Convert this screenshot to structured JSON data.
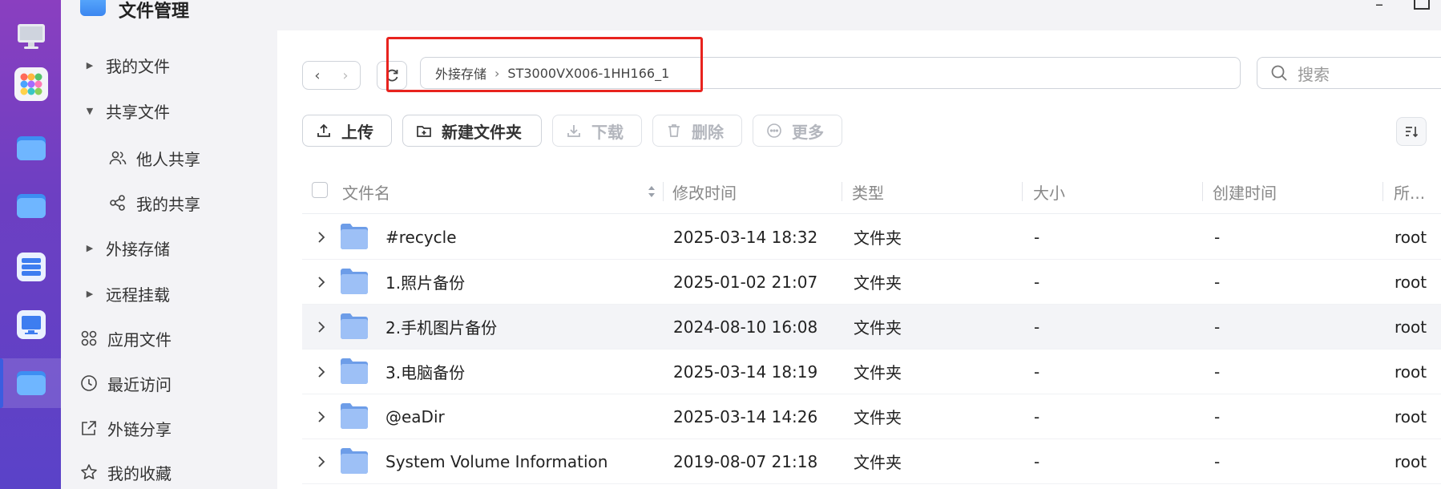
{
  "app": {
    "title": "文件管理"
  },
  "sidebar": {
    "items": [
      {
        "label": "我的文件",
        "caret": "right"
      },
      {
        "label": "共享文件",
        "caret": "down"
      },
      {
        "label": "他人共享",
        "icon": "users-icon"
      },
      {
        "label": "我的共享",
        "icon": "share-icon"
      },
      {
        "label": "外接存储",
        "caret": "right"
      },
      {
        "label": "远程挂载",
        "caret": "right"
      },
      {
        "label": "应用文件",
        "icon": "apps-grid-icon"
      },
      {
        "label": "最近访问",
        "icon": "clock-icon"
      },
      {
        "label": "外链分享",
        "icon": "external-share-icon"
      },
      {
        "label": "我的收藏",
        "icon": "star-icon"
      }
    ]
  },
  "path": {
    "segments": [
      "外接存储",
      "ST3000VX006-1HH166_1"
    ]
  },
  "search": {
    "placeholder": "搜索"
  },
  "toolbar": {
    "upload": "上传",
    "new_folder": "新建文件夹",
    "download": "下载",
    "delete": "删除",
    "more": "更多"
  },
  "table": {
    "headers": [
      "文件名",
      "修改时间",
      "类型",
      "大小",
      "创建时间",
      "所..."
    ],
    "rows": [
      {
        "name": "#recycle",
        "modified": "2025-03-14 18:32",
        "type": "文件夹",
        "size": "-",
        "created": "-",
        "owner": "root"
      },
      {
        "name": "1.照片备份",
        "modified": "2025-01-02 21:07",
        "type": "文件夹",
        "size": "-",
        "created": "-",
        "owner": "root"
      },
      {
        "name": "2.手机图片备份",
        "modified": "2024-08-10 16:08",
        "type": "文件夹",
        "size": "-",
        "created": "-",
        "owner": "root"
      },
      {
        "name": "3.电脑备份",
        "modified": "2025-03-14 18:19",
        "type": "文件夹",
        "size": "-",
        "created": "-",
        "owner": "root"
      },
      {
        "name": "@eaDir",
        "modified": "2025-03-14 14:26",
        "type": "文件夹",
        "size": "-",
        "created": "-",
        "owner": "root"
      },
      {
        "name": "System Volume Information",
        "modified": "2019-08-07 21:18",
        "type": "文件夹",
        "size": "-",
        "created": "-",
        "owner": "root"
      }
    ]
  },
  "colors": {
    "highlight_box": "#e8231e",
    "folder": "#8fb6f5",
    "dock_gradient_top": "#8a3fc0",
    "dock_gradient_bottom": "#5a42c8"
  }
}
